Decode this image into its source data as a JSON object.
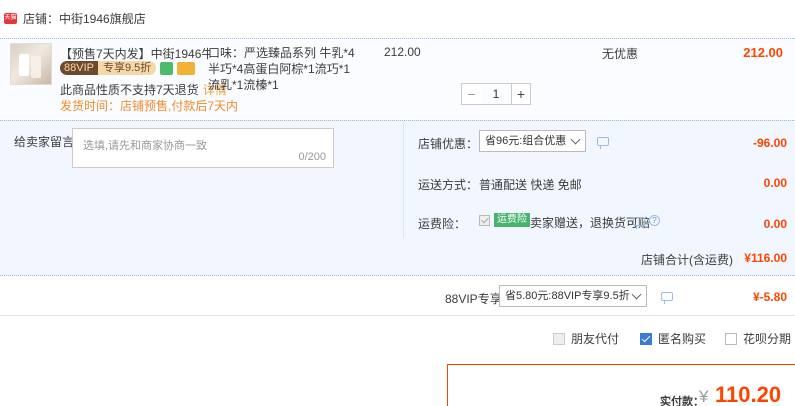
{
  "shop": {
    "tag": "天猫",
    "label": "店铺：中街1946旗舰店"
  },
  "item": {
    "title": "【预售7天内发】中街1946牛乳...",
    "vip_left": "88VIP",
    "vip_right": "专享9.5折",
    "no_return": "此商品性质不支持7天退货",
    "detail_link": "详情",
    "ship_time": "发货时间：店铺预售,付款后7天内",
    "spec": "口味：严选臻品系列 牛乳*4半巧*4高蛋白阿棕*1流巧*1流乳*1流榛*1",
    "price": "212.00",
    "qty": "1",
    "qty_minus": "−",
    "qty_plus": "+",
    "discount": "无优惠",
    "total": "212.00"
  },
  "message": {
    "label": "给卖家留言：",
    "placeholder": "选填,请先和商家协商一致",
    "count": "0/200"
  },
  "coupon": {
    "label": "店铺优惠：",
    "selected": "省96元:组合优惠",
    "value": "-96.00"
  },
  "shipping": {
    "label": "运送方式：",
    "method": "普通配送 快递 免邮",
    "value": "0.00"
  },
  "insurance": {
    "label": "运费险：",
    "tag": "运费险",
    "text": "卖家赠送，退换货可赔",
    "help": "?",
    "value": "0.00"
  },
  "shop_total": {
    "label": "店铺合计(含运费)",
    "value": "¥116.00"
  },
  "vip": {
    "label": "88VIP专享",
    "selected": "省5.80元:88VIP专享9.5折",
    "value": "¥-5.80"
  },
  "options": {
    "friend_pay": "朋友代付",
    "anonymous": "匿名购买",
    "huabei": "花呗分期"
  },
  "payment": {
    "label": "实付款：",
    "currency": "¥",
    "value": "110.20"
  },
  "colors": {
    "accent": "#ff4400",
    "link_blue": "#3a7bd5",
    "panel_bg": "#f2f7ff"
  }
}
